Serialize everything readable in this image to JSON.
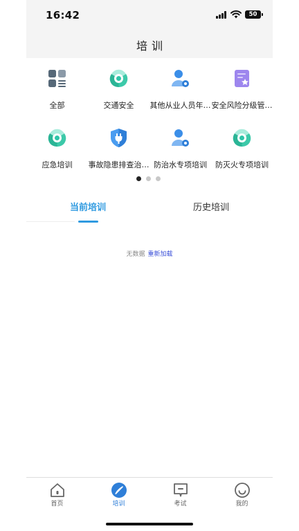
{
  "status_bar": {
    "time": "16:42",
    "battery": "50"
  },
  "header": {
    "title": "培训"
  },
  "categories": [
    {
      "label": "全部",
      "icon": "grid-list-icon"
    },
    {
      "label": "交通安全",
      "icon": "radiation-icon"
    },
    {
      "label": "其他从业人员年…",
      "icon": "user-settings-icon"
    },
    {
      "label": "安全风险分级管…",
      "icon": "document-star-icon"
    },
    {
      "label": "应急培训",
      "icon": "radiation-icon"
    },
    {
      "label": "事故隐患排查治…",
      "icon": "shield-plug-icon"
    },
    {
      "label": "防治水专项培训",
      "icon": "user-settings-icon"
    },
    {
      "label": "防灭火专项培训",
      "icon": "radiation-icon"
    }
  ],
  "pager": {
    "count": 3,
    "active": 0
  },
  "tabs": [
    {
      "label": "当前培训",
      "active": true
    },
    {
      "label": "历史培训",
      "active": false
    }
  ],
  "empty_state": {
    "message": "无数据",
    "reload": "重新加载"
  },
  "tabbar": [
    {
      "label": "首页",
      "icon": "home-icon",
      "active": false
    },
    {
      "label": "培训",
      "icon": "compass-icon",
      "active": true
    },
    {
      "label": "考试",
      "icon": "message-icon",
      "active": false
    },
    {
      "label": "我的",
      "icon": "smile-icon",
      "active": false
    }
  ],
  "colors": {
    "accent": "#2f9ae0",
    "teal": "#2ec4a8",
    "blue": "#3b8ee8",
    "purple": "#8c6fe8"
  }
}
